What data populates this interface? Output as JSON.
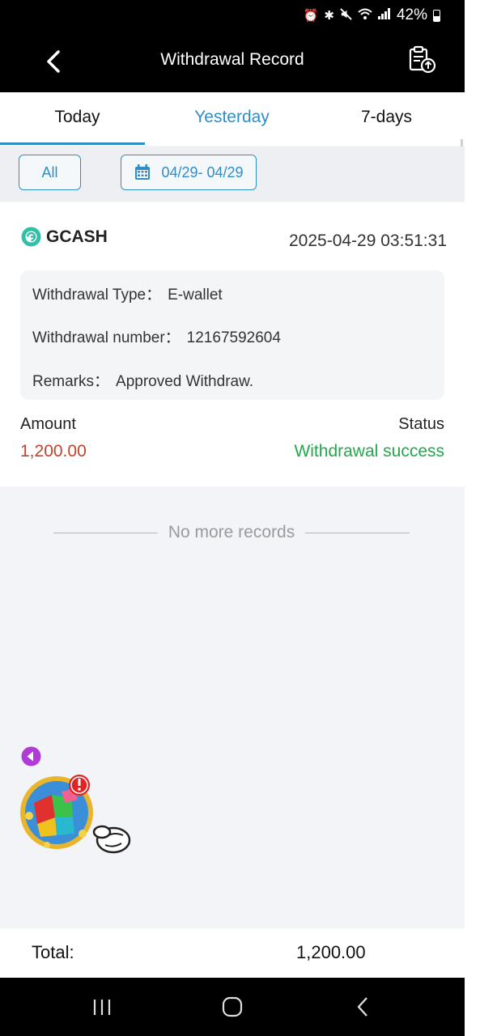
{
  "status_bar": {
    "battery_text": "42%"
  },
  "header": {
    "title": "Withdrawal Record"
  },
  "tabs": [
    {
      "label": "Today"
    },
    {
      "label": "Yesterday"
    },
    {
      "label": "7-days"
    }
  ],
  "filters": {
    "all_label": "All",
    "date_range": "04/29- 04/29"
  },
  "record": {
    "method": "GCASH",
    "time": "2025-04-29 03:51:31",
    "type_label": "Withdrawal Type：",
    "type_value": "E-wallet",
    "number_label": "Withdrawal number：",
    "number_value": "12167592604",
    "remarks_label": "Remarks：",
    "remarks_value": "Approved Withdraw.",
    "amount_label": "Amount",
    "amount_value": "1,200.00",
    "status_label": "Status",
    "status_value": "Withdrawal success"
  },
  "list_end_text": "No more records",
  "footer": {
    "total_label": "Total:",
    "total_value": "1,200.00"
  },
  "colors": {
    "accent": "#2f8dc5",
    "amount": "#c0442d",
    "success": "#22a84a",
    "header_bg": "#000000"
  },
  "icons": {
    "status_bar": [
      "alarm-icon",
      "bluetooth-icon",
      "mute-icon",
      "wifi-icon",
      "signal-icon",
      "battery-icon"
    ],
    "header": [
      "back-arrow-icon",
      "export-record-icon"
    ],
    "filters": [
      "calendar-icon"
    ],
    "record": [
      "gcash-logo-icon"
    ],
    "floating": [
      "collapse-arrow-icon",
      "game-globe-icon",
      "alert-badge-icon",
      "glove-pointer-icon"
    ],
    "nav": [
      "recent-apps-icon",
      "home-icon",
      "back-icon"
    ]
  }
}
